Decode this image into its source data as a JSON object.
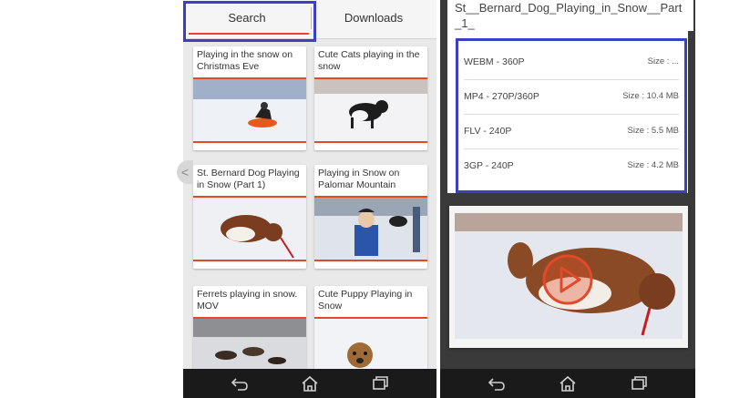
{
  "tabs": {
    "search_label": "Search",
    "downloads_label": "Downloads"
  },
  "search_results": [
    {
      "title": "Playing in the snow on Christmas Eve"
    },
    {
      "title": "Cute Cats playing in the snow"
    },
    {
      "title": "St. Bernard Dog Playing in Snow (Part 1)"
    },
    {
      "title": "Playing in Snow on Palomar Mountain"
    },
    {
      "title": "Ferrets playing in snow. MOV"
    },
    {
      "title": "Cute Puppy Playing in Snow"
    }
  ],
  "download_panel": {
    "file_title": "St__Bernard_Dog_Playing_in_Snow__Part _1_",
    "formats": [
      {
        "label": "WEBM - 360P",
        "size": "Size : ..."
      },
      {
        "label": "MP4 - 270P/360P",
        "size": "Size : 10.4 MB"
      },
      {
        "label": "FLV - 240P",
        "size": "Size : 5.5 MB"
      },
      {
        "label": "3GP - 240P",
        "size": "Size : 4.2 MB"
      }
    ]
  },
  "navbar": {
    "back_icon": "back-icon",
    "home_icon": "home-icon",
    "recents_icon": "recents-icon"
  },
  "colors": {
    "accent": "#e0492a",
    "highlight_box": "#3b3fc1",
    "navbar": "#1a1a1a"
  }
}
